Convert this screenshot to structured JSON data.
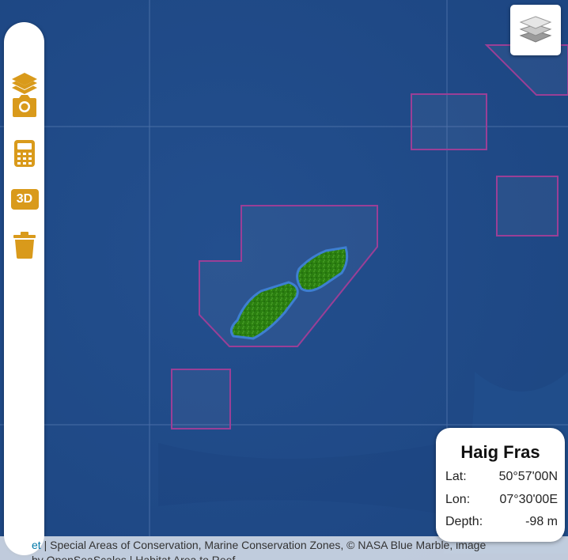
{
  "map": {
    "colors": {
      "sea": "#1f4a86",
      "boundary": "#9b3f96",
      "habitat_fill": "#2a7d12",
      "habitat_outline": "#3d7fd1",
      "accent": "#d99a1b"
    }
  },
  "toolbar": {
    "items": [
      {
        "icon": "layers-icon"
      },
      {
        "icon": "camera-icon"
      },
      {
        "icon": "calculator-icon"
      },
      {
        "icon": "3d-view-icon",
        "label": "3D"
      },
      {
        "icon": "trash-icon"
      }
    ]
  },
  "layers_button": {
    "icon": "layers-stack-icon"
  },
  "attribution": {
    "link_text": "et",
    "text": " | Special Areas of Conservation, Marine Conservation Zones, © NASA Blue Marble, image",
    "line2": "by OpenSeaScales | Habitat Area to Reef"
  },
  "info": {
    "title": "Haig Fras",
    "lat_label": "Lat:",
    "lat_value": "50°57'00N",
    "lon_label": "Lon:",
    "lon_value": "07°30'00E",
    "depth_label": "Depth:",
    "depth_value": "-98 m"
  }
}
